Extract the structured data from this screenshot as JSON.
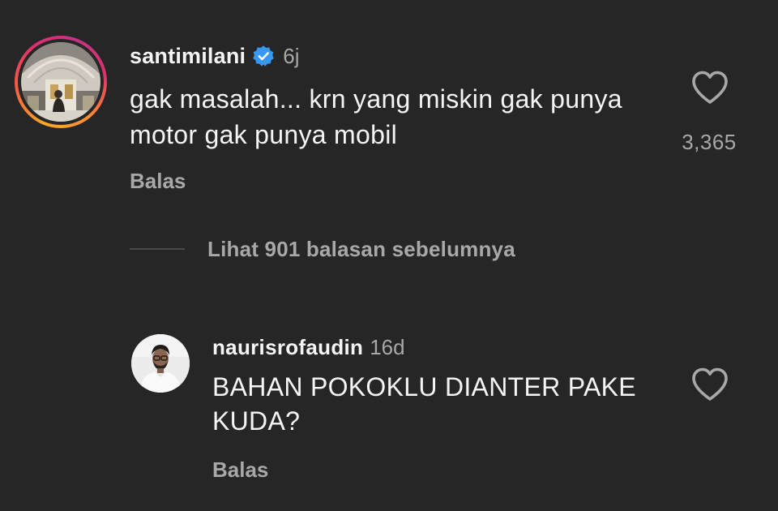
{
  "comment": {
    "username": "santimilani",
    "verified": true,
    "time": "6j",
    "text": "gak masalah... krn yang miskin gak punya motor gak punya mobil",
    "reply_label": "Balas",
    "like_count": "3,365",
    "like_icon": "heart-outline-icon"
  },
  "view_previous": {
    "label": "Lihat 901 balasan sebelumnya"
  },
  "reply": {
    "username": "naurisrofaudin",
    "time": "16d",
    "text": "BAHAN POKOKLU DIANTER PAKE KUDA?",
    "reply_label": "Balas",
    "like_icon": "heart-outline-icon"
  },
  "colors": {
    "background": "#262626",
    "primary_text": "#f5f5f5",
    "secondary_text": "#a8a8a8",
    "verified_badge": "#3897f0",
    "story_ring_start": "#f9a825",
    "story_ring_end": "#c13584"
  }
}
